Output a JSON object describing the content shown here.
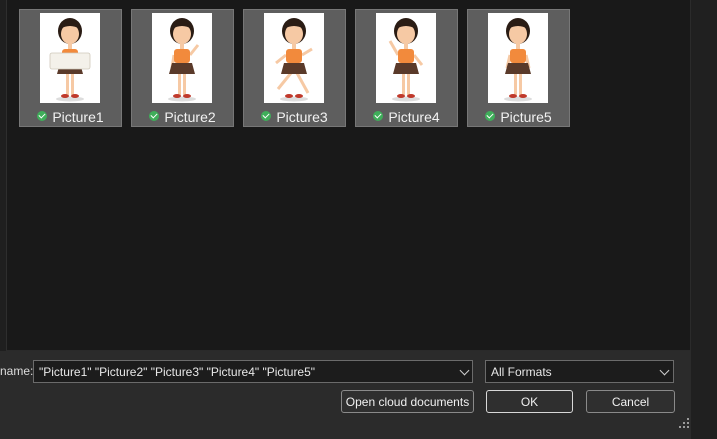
{
  "files": [
    {
      "name": "Picture1",
      "pose": "sign"
    },
    {
      "name": "Picture2",
      "pose": "point"
    },
    {
      "name": "Picture3",
      "pose": "run"
    },
    {
      "name": "Picture4",
      "pose": "wave"
    },
    {
      "name": "Picture5",
      "pose": "stand"
    }
  ],
  "footer": {
    "name_label": "name:",
    "file_name_value": "\"Picture1\" \"Picture2\" \"Picture3\" \"Picture4\" \"Picture5\"",
    "format_value": "All Formats",
    "cloud_button": "Open cloud documents",
    "ok_button": "OK",
    "cancel_button": "Cancel"
  },
  "colors": {
    "tile_bg": "#5e5e5e",
    "check_green": "#3fae5a",
    "girl_top": "#f28a3c",
    "girl_skirt": "#5a3a2a",
    "hair": "#2a1c14"
  },
  "icons": [
    "check-icon",
    "chevron-down-icon",
    "resize-grip-icon"
  ]
}
